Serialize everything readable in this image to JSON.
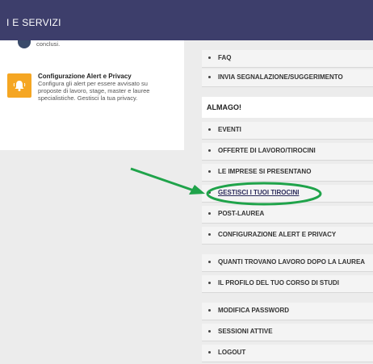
{
  "topbar": {
    "title": "I E SERVIZI"
  },
  "left_panel": {
    "cut_text": "conclusi.",
    "alert": {
      "title": "Configurazione Alert e Privacy",
      "description": "Configura gli alert per essere avvisato su proposte di lavoro, stage, master e lauree specialistiche. Gestisci la tua privacy."
    }
  },
  "menu": {
    "group1": [
      "FAQ",
      "INVIA SEGNALAZIONE/SUGGERIMENTO"
    ],
    "section_title": "ALMAGO!",
    "group2": [
      "EVENTI",
      "OFFERTE DI LAVORO/TIROCINI",
      "LE IMPRESE SI PRESENTANO",
      "GESTISCI I TUOI TIROCINI",
      "POST-LAUREA",
      "CONFIGURAZIONE ALERT E PRIVACY"
    ],
    "group3": [
      "QUANTI TROVANO LAVORO DOPO LA LAUREA",
      "IL PROFILO DEL TUO CORSO DI STUDI"
    ],
    "group4": [
      "MODIFICA PASSWORD",
      "SESSIONI ATTIVE",
      "LOGOUT"
    ]
  },
  "annotation": {
    "color": "#1fa34a"
  },
  "colors": {
    "topbar": "#3d3e6b",
    "alert_icon": "#f5a623"
  }
}
